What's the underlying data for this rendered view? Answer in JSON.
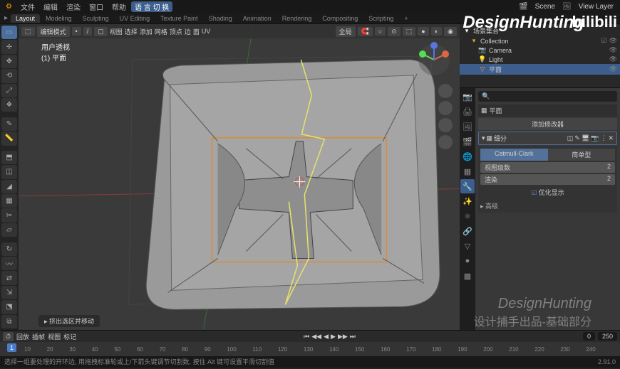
{
  "menus": {
    "file": "文件",
    "edit": "编辑",
    "render": "渲染",
    "window": "窗口",
    "help": "帮助",
    "tab_active": "语 言 切 换"
  },
  "workspaces": [
    "Layout",
    "Modeling",
    "Sculpting",
    "UV Editing",
    "Texture Paint",
    "Shading",
    "Animation",
    "Rendering",
    "Compositing",
    "Scripting"
  ],
  "scene": {
    "name": "Scene",
    "view_layer": "View Layer"
  },
  "vp_header": {
    "mode": "编辑模式",
    "v": "视图",
    "sel": "选择",
    "add": "添加",
    "mesh": "网格",
    "vert": "顶点",
    "edge": "边",
    "face": "面",
    "uv": "UV",
    "hdr_btns": [
      "全局"
    ]
  },
  "vp_info": {
    "title": "用户透视",
    "obj": "(1) 平面"
  },
  "statusline": "挤出选区并移动",
  "outliner": {
    "scene": "场景集合",
    "collection": "Collection",
    "items": [
      {
        "name": "Camera",
        "icon": "📷"
      },
      {
        "name": "Light",
        "icon": "💡"
      },
      {
        "name": "平面",
        "icon": "▽",
        "active": true
      }
    ]
  },
  "props": {
    "search_placeholder": "",
    "object": "平面",
    "add_mod": "添加修改器",
    "mod_name": "细分",
    "mod_type": "Catmull-Clark",
    "mod_simple": "简单型",
    "viewport_lvl": {
      "label": "视图级数",
      "value": "2"
    },
    "render_lvl": {
      "label": "渲染",
      "value": "2"
    },
    "optimal": "优化显示",
    "advanced": "高级"
  },
  "timeline": {
    "play": "回放",
    "keying": "插帧",
    "view": "视图",
    "marker": "标记",
    "start": "0",
    "end": "250",
    "current": "1",
    "ticks": [
      "10",
      "20",
      "30",
      "40",
      "50",
      "60",
      "70",
      "80",
      "90",
      "100",
      "110",
      "120",
      "130",
      "140",
      "150",
      "160",
      "170",
      "180",
      "190",
      "200",
      "210",
      "220",
      "230",
      "240"
    ]
  },
  "bottom": {
    "hint": "选择一组要处理的开环边, 用拖拽标准轮或上/下箭头键调节切割数, 按住 Alt 键可设置平滑切割值",
    "version": "2.91.0"
  },
  "watermark": {
    "brand": "DesignHunting",
    "site": "bilibili",
    "sub": "设计捕手出品-基础部分"
  }
}
